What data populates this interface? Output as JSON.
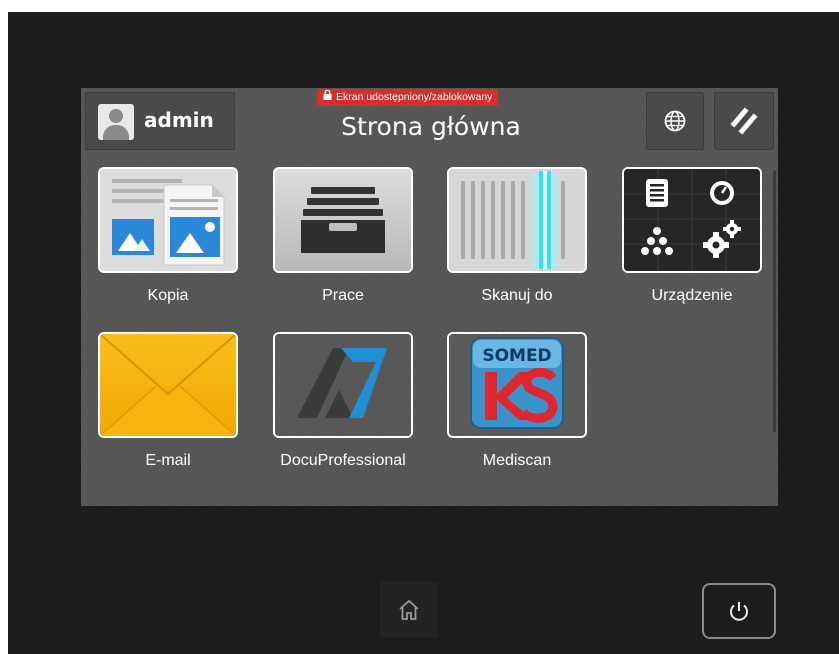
{
  "header": {
    "user_name": "admin",
    "title": "Strona główna",
    "lock_banner": "Ekran udostępniony/zablokowany",
    "language_icon": "globe-icon",
    "reset_icon": "reset-slash-icon"
  },
  "tiles": [
    {
      "label": "Kopia",
      "icon": "copy-icon"
    },
    {
      "label": "Prace",
      "icon": "jobs-tray-icon"
    },
    {
      "label": "Skanuj do",
      "icon": "scan-icon"
    },
    {
      "label": "Urządzenie",
      "icon": "device-settings-icon"
    },
    {
      "label": "E-mail",
      "icon": "envelope-icon"
    },
    {
      "label": "DocuProfessional",
      "icon": "docuprofessional-logo"
    },
    {
      "label": "Mediscan",
      "icon": "somed-ks-logo",
      "logo_text": "SOMED"
    }
  ],
  "footer": {
    "home_icon": "home-icon",
    "power_icon": "power-icon"
  },
  "colors": {
    "screen_bg": "#555555",
    "banner": "#d32f2f",
    "scan_beam": "#29e6f0",
    "email_yellow": "#f5b400"
  }
}
